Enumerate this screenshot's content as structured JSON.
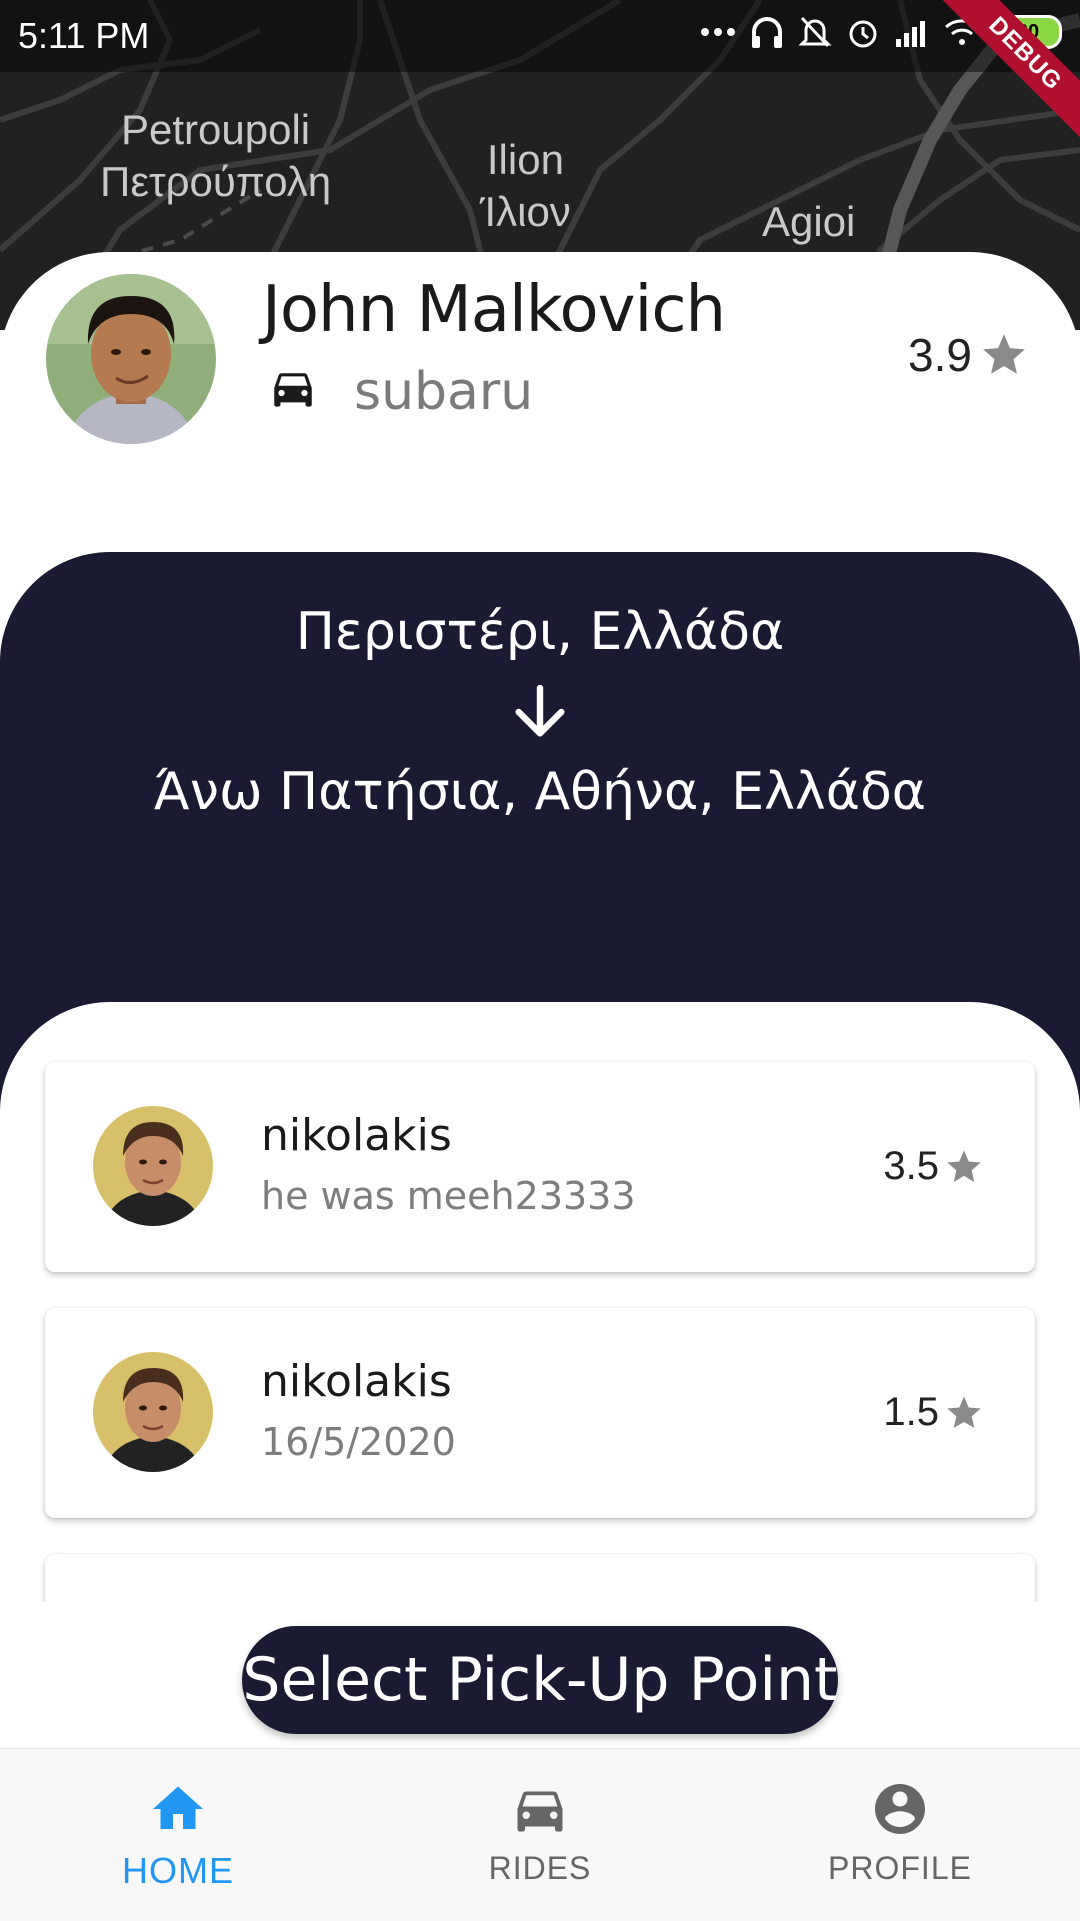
{
  "status_bar": {
    "time": "5:11 PM",
    "battery": "60",
    "debug_label": "DEBUG"
  },
  "map": {
    "labels": [
      {
        "line1": "Petroupoli",
        "line2": "Πετρούπολη"
      },
      {
        "line1": "Ilion",
        "line2": "Ίλιον"
      },
      {
        "line1": "Agioi",
        "line2": ""
      }
    ]
  },
  "driver": {
    "name": "John Malkovich",
    "car": "subaru",
    "rating": "3.9",
    "icons": {
      "car": "car-icon",
      "star": "star-icon"
    }
  },
  "route": {
    "from": "Περιστέρι, Ελλάδα",
    "to": "Άνω Πατήσια, Αθήνα, Ελλάδα",
    "arrow_icon": "arrow-down-icon"
  },
  "reviews": [
    {
      "name": "nikolakis",
      "text": "he was meeh23333",
      "rating": "3.5"
    },
    {
      "name": "nikolakis",
      "text": "16/5/2020",
      "rating": "1.5"
    }
  ],
  "pickup_button": {
    "label": "Select Pick-Up Point"
  },
  "bottom_nav": {
    "items": [
      {
        "label": "HOME",
        "icon": "home-icon",
        "active": true
      },
      {
        "label": "RIDES",
        "icon": "car-icon",
        "active": false
      },
      {
        "label": "PROFILE",
        "icon": "account-icon",
        "active": false
      }
    ]
  },
  "colors": {
    "panel_dark": "#1b1a33",
    "accent_blue": "#2196f3",
    "star_gray": "#8a8a8a",
    "map_dark": "#212121"
  }
}
